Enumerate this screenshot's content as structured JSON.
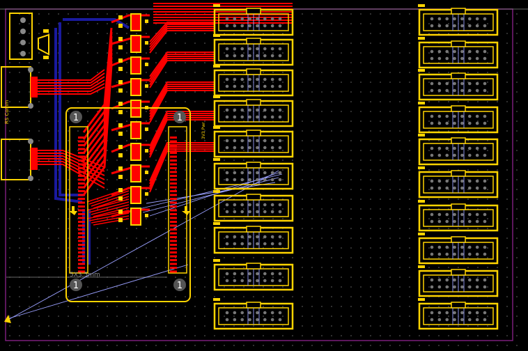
{
  "colors": {
    "background": "#000000",
    "board_edge": "#7a1f7a",
    "silkscreen": "#ffd400",
    "copper_top": "#ff0000",
    "copper_bottom": "#1a1a9e",
    "ratsnest": "#9aa0ff",
    "grid_dot": "#6a6a6a",
    "pad": "#ffd400",
    "pin_marker": "#555555"
  },
  "module": {
    "pin1_label": "1",
    "size_label": "5X3.5mm",
    "side_label": "3V3 Pwr"
  },
  "left_labels": {
    "connector_label": "RS Comm"
  }
}
